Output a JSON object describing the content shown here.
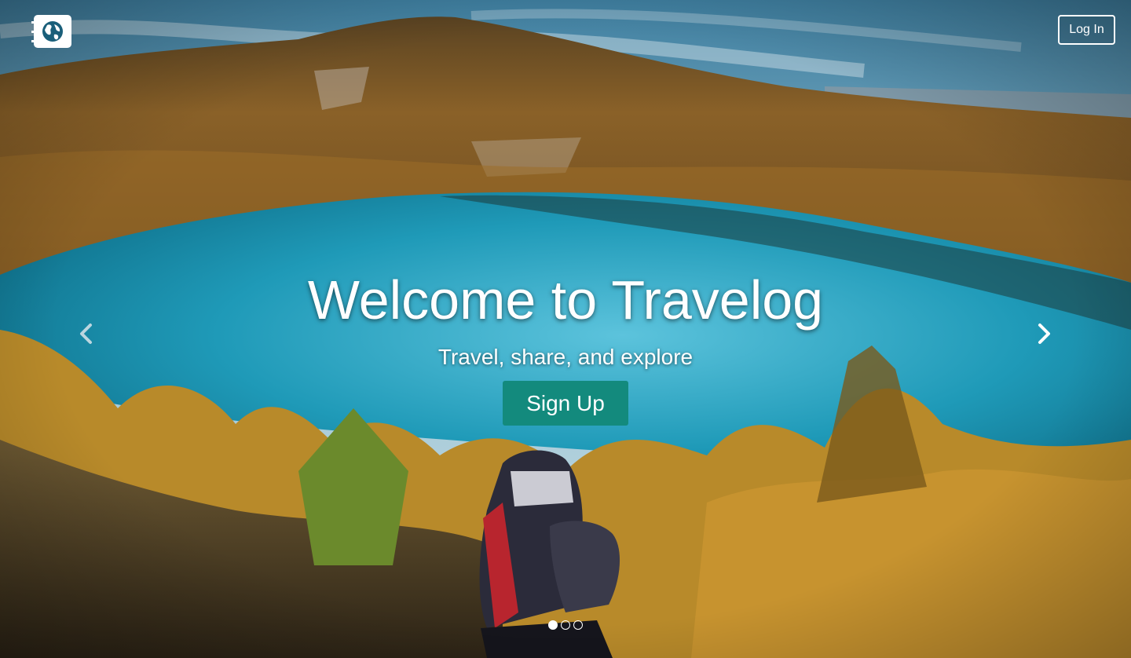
{
  "nav": {
    "logo_icon": "globe-logo-icon",
    "login_label": "Log In"
  },
  "hero": {
    "title": "Welcome to Travelog",
    "subtitle": "Travel, share, and explore",
    "signup_label": "Sign Up",
    "background": "photo: view from a hillside over a turquoise lake surrounded by golden larch forest, sneakers in foreground",
    "accent_color": "#138a7d"
  },
  "carousel": {
    "prev_icon": "chevron-left-icon",
    "next_icon": "chevron-right-icon",
    "slide_count": 3,
    "active_slide": 1
  }
}
